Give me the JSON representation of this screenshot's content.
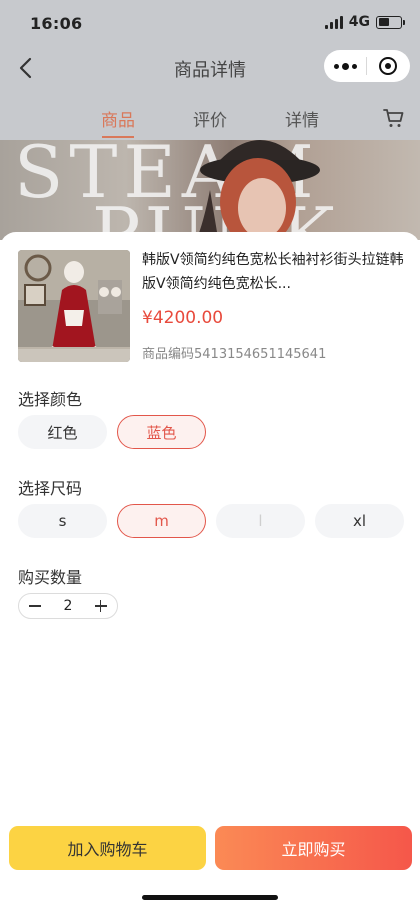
{
  "status_bar": {
    "time": "16:06",
    "network": "4G",
    "battery_level": 0.5
  },
  "nav": {
    "title": "商品详情"
  },
  "tabs": [
    {
      "label": "商品",
      "active": true
    },
    {
      "label": "评价",
      "active": false
    },
    {
      "label": "详情",
      "active": false
    }
  ],
  "banner": {
    "line1": "STEAM",
    "line2": "PUNK"
  },
  "product": {
    "name": "韩版V领简约纯色宽松长袖衬衫街头拉链韩版V领简约纯色宽松长...",
    "price": "¥4200.00",
    "code": "商品编码5413154651145641"
  },
  "color_section": {
    "title": "选择颜色",
    "options": [
      {
        "label": "红色",
        "selected": false
      },
      {
        "label": "蓝色",
        "selected": true
      }
    ]
  },
  "size_section": {
    "title": "选择尺码",
    "options": [
      {
        "label": "s",
        "selected": false,
        "disabled": false
      },
      {
        "label": "m",
        "selected": true,
        "disabled": false
      },
      {
        "label": "l",
        "selected": false,
        "disabled": true
      },
      {
        "label": "xl",
        "selected": false,
        "disabled": false
      }
    ]
  },
  "quantity_section": {
    "title": "购买数量",
    "value": "2"
  },
  "actions": {
    "add_to_cart": "加入购物车",
    "buy_now": "立即购买"
  },
  "colors": {
    "accent": "#e2564a",
    "tab_active": "#d9785a",
    "cart_button": "#fcd343",
    "buy_gradient": [
      "#fb8a55",
      "#f5574a"
    ],
    "price": "#e84a3c"
  }
}
